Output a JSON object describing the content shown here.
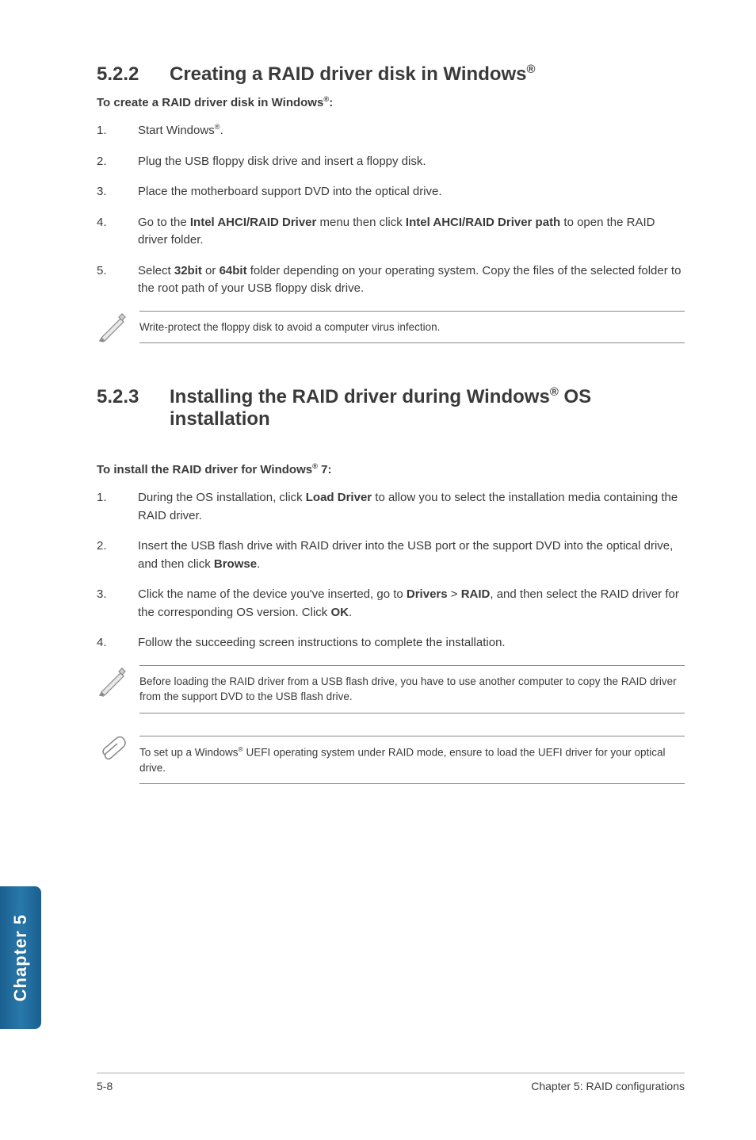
{
  "section1": {
    "number": "5.2.2",
    "title_pre": "Creating a RAID driver disk in Windows",
    "title_reg": "®",
    "intro_pre": "To create a RAID driver disk in Windows",
    "intro_reg": "®",
    "intro_post": ":",
    "items": [
      {
        "n": "1.",
        "t_pre": "Start Windows",
        "t_reg": "®",
        "t_post": "."
      },
      {
        "n": "2.",
        "t": "Plug the USB floppy disk drive and insert a floppy disk."
      },
      {
        "n": "3.",
        "t": "Place the motherboard support DVD into the optical drive."
      },
      {
        "n": "4.",
        "t_html": "Go to the <b>Intel AHCI/RAID Driver</b> menu then click <b>Intel AHCI/RAID Driver path</b> to open the RAID driver folder."
      },
      {
        "n": "5.",
        "t_html": "Select <b>32bit</b> or <b>64bit</b> folder depending on your operating system. Copy the files of the selected folder to the root path of your USB floppy disk drive."
      }
    ],
    "note": "Write-protect the floppy disk to avoid a computer virus infection."
  },
  "section2": {
    "number": "5.2.3",
    "title_pre": "Installing the RAID driver during Windows",
    "title_reg": "®",
    "title_post": " OS installation",
    "intro_pre": "To install the RAID driver for Windows",
    "intro_reg": "®",
    "intro_post": " 7:",
    "items": [
      {
        "n": "1.",
        "t_html": "During the OS installation, click <b>Load Driver</b> to allow you to select the installation media containing the RAID driver."
      },
      {
        "n": "2.",
        "t_html": "Insert the USB flash drive with RAID driver into the USB port or the support DVD into the optical drive, and then click <b>Browse</b>."
      },
      {
        "n": "3.",
        "t_html": "Click the name of the device you've inserted, go to <b>Drivers</b> > <b>RAID</b>, and then select the RAID driver for the corresponding OS version. Click <b>OK</b>."
      },
      {
        "n": "4.",
        "t": "Follow the succeeding screen instructions to complete the installation."
      }
    ],
    "note1": "Before loading the RAID driver from a USB flash drive, you have to use another computer to copy the RAID driver from the support DVD to the USB flash drive.",
    "note2_pre": "To set up a Windows",
    "note2_reg": "®",
    "note2_post": " UEFI operating system under RAID mode, ensure to load the UEFI driver for your optical drive."
  },
  "sidetab": "Chapter 5",
  "footer": {
    "left": "5-8",
    "right": "Chapter 5: RAID configurations"
  }
}
